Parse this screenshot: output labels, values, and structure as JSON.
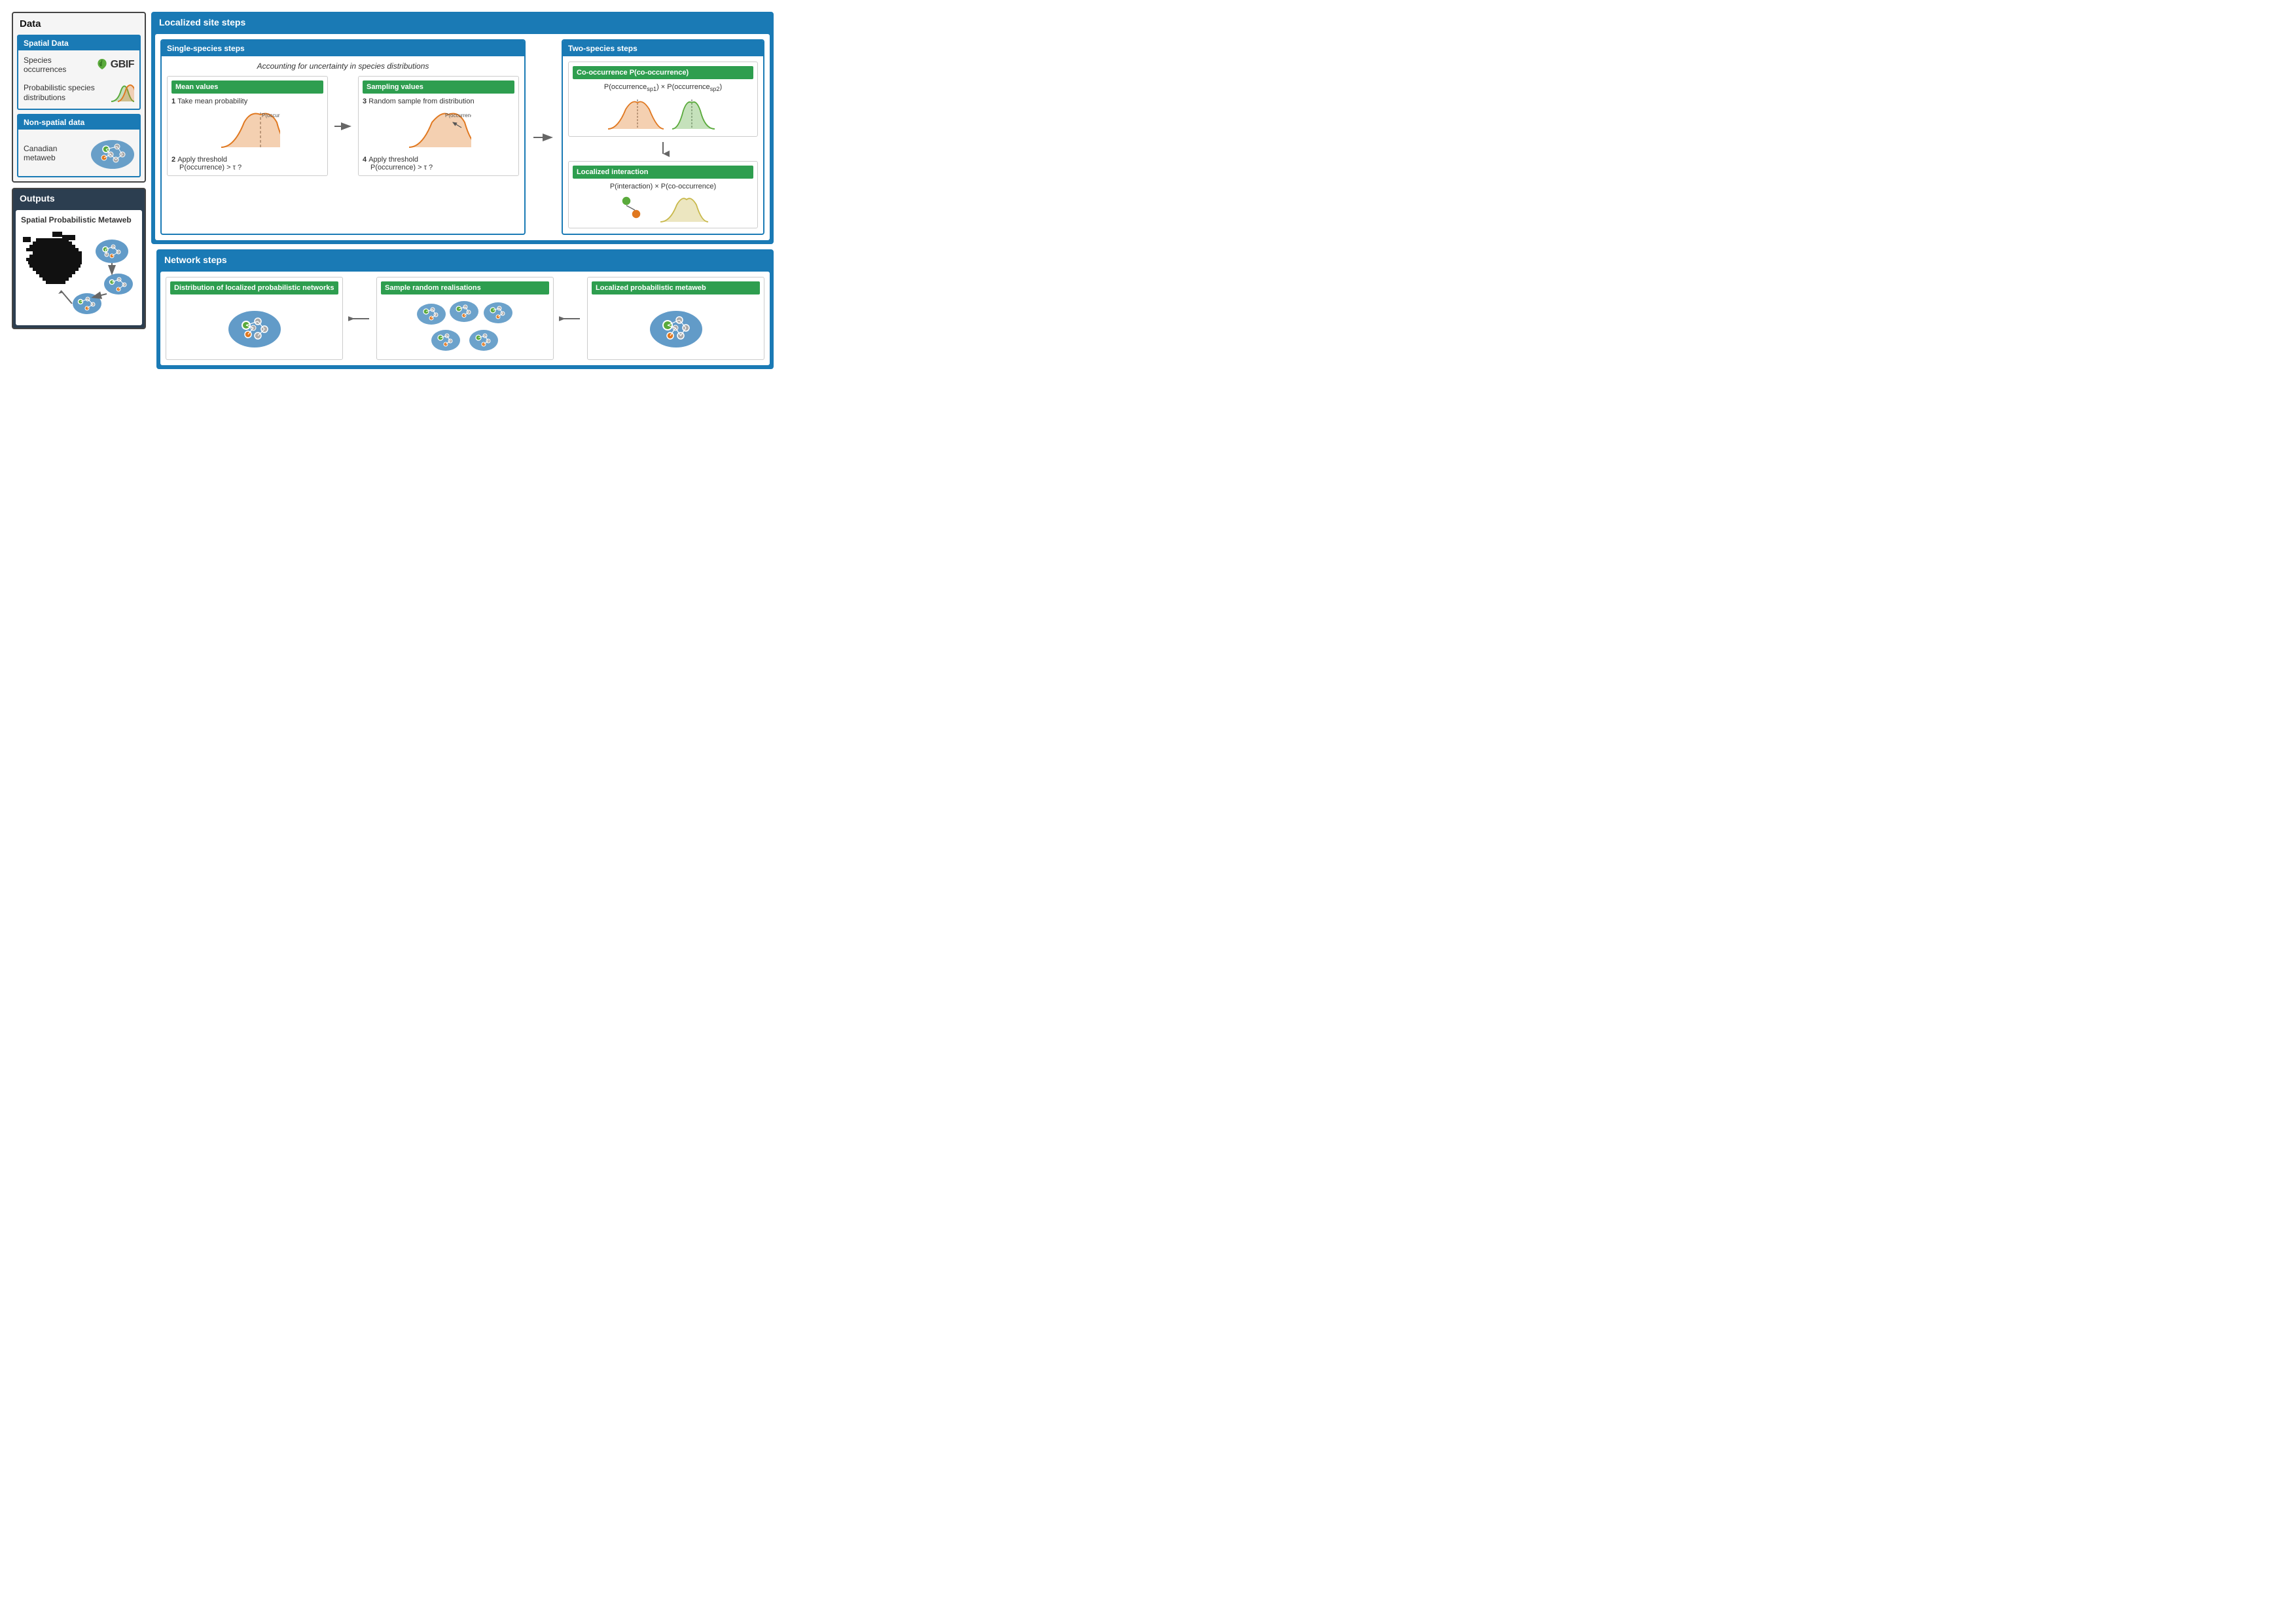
{
  "sections": {
    "data_panel": {
      "title": "Data",
      "spatial_data": {
        "title": "Spatial Data",
        "item1": "Species occurrences",
        "item2": "Probabilistic species distributions",
        "gbif_label": "GBIF"
      },
      "nonspatial_data": {
        "title": "Non-spatial data",
        "item1": "Canadian metaweb"
      }
    },
    "outputs_panel": {
      "title": "Outputs",
      "item1": "Spatial Probabilistic Metaweb"
    },
    "localized_site": {
      "title": "Localized site steps",
      "single_species": {
        "title": "Single-species steps",
        "subtitle": "Accounting for uncertainty in species distributions",
        "mean_values": {
          "title": "Mean values",
          "step1": "Take mean probability",
          "step2": "Apply threshold",
          "formula2": "P(occurrence) > τ ?"
        },
        "sampling_values": {
          "title": "Sampling values",
          "step3": "Random sample from distribution",
          "step4": "Apply threshold",
          "formula4": "P(occurrence) > τ ?"
        }
      },
      "two_species": {
        "title": "Two-species steps",
        "cooccurrence": {
          "title": "Co-occurrence P(co-occurrence)",
          "formula": "P(occurrencesp1) × P(occurrencesp2)"
        },
        "localized_interaction": {
          "title": "Localized interaction",
          "formula": "P(interaction) × P(co-occurrence)"
        }
      }
    },
    "network_steps": {
      "title": "Network steps",
      "box1": {
        "title": "Distribution of localized probabilistic networks"
      },
      "box2": {
        "title": "Sample random realisations"
      },
      "box3": {
        "title": "Localized probabilistic metaweb"
      }
    }
  }
}
